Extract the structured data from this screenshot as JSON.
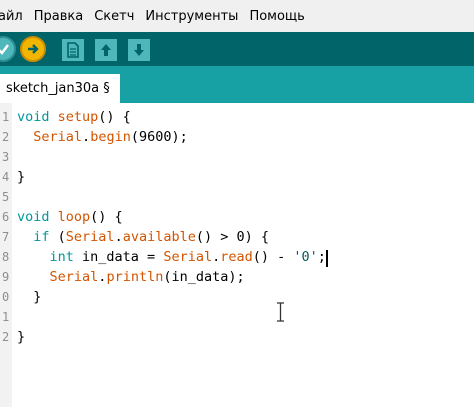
{
  "menu": {
    "items": [
      "айл",
      "Правка",
      "Скетч",
      "Инструменты",
      "Помощь"
    ]
  },
  "toolbar": {
    "buttons": [
      {
        "name": "verify",
        "icon": "check-icon"
      },
      {
        "name": "upload",
        "icon": "arrow-right-icon"
      },
      {
        "name": "new",
        "icon": "file-icon"
      },
      {
        "name": "open",
        "icon": "arrow-up-icon"
      },
      {
        "name": "save",
        "icon": "arrow-down-icon"
      }
    ]
  },
  "tab": {
    "label": "sketch_jan30a §"
  },
  "editor": {
    "line_numbers": [
      "1",
      "2",
      "3",
      "4",
      "5",
      "6",
      "7",
      "8",
      "9",
      "0",
      "1",
      "2"
    ],
    "lines": [
      "void setup() {",
      "  Serial.begin(9600);",
      "",
      "}",
      "",
      "void loop() {",
      "  if (Serial.available() > 0) {",
      "    int in_data = Serial.read() - '0';",
      "    Serial.println(in_data);",
      "  }",
      "",
      "}"
    ]
  },
  "colors": {
    "toolbar_bg": "#006468",
    "tabstrip_bg": "#17a1a5",
    "keyword": "#00979c",
    "function": "#d35400",
    "upload_button": "#f2b600"
  }
}
